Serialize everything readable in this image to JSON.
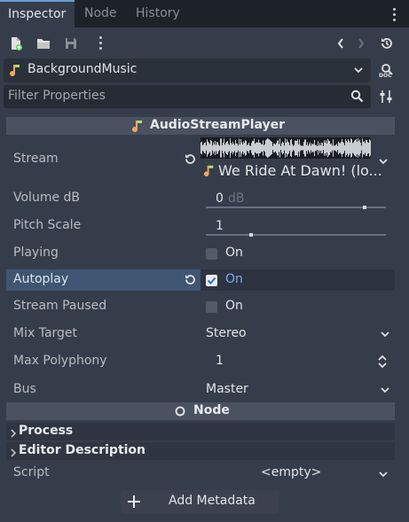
{
  "tabs": [
    {
      "label": "Inspector",
      "active": true
    },
    {
      "label": "Node",
      "active": false
    },
    {
      "label": "History",
      "active": false
    }
  ],
  "object": {
    "name": "BackgroundMusic",
    "icon": "audio-stream-icon"
  },
  "filter": {
    "placeholder": "Filter Properties"
  },
  "section": {
    "title": "AudioStreamPlayer",
    "icon": "audio-stream-icon"
  },
  "props": {
    "stream": {
      "label": "Stream",
      "value": "We Ride At Dawn! (lo..."
    },
    "volume": {
      "label": "Volume dB",
      "value": "0",
      "unit": "dB",
      "level": 0.88
    },
    "pitch": {
      "label": "Pitch Scale",
      "value": "1",
      "level": 0.25
    },
    "playing": {
      "label": "Playing",
      "value": "On",
      "checked": false
    },
    "autoplay": {
      "label": "Autoplay",
      "value": "On",
      "checked": true
    },
    "paused": {
      "label": "Stream Paused",
      "value": "On",
      "checked": false
    },
    "mix": {
      "label": "Mix Target",
      "value": "Stereo"
    },
    "poly": {
      "label": "Max Polyphony",
      "value": "1"
    },
    "bus": {
      "label": "Bus",
      "value": "Master"
    }
  },
  "node_section": {
    "title": "Node"
  },
  "groups": {
    "process": "Process",
    "editor": "Editor Description"
  },
  "script": {
    "label": "Script",
    "value": "<empty>"
  },
  "add_metadata": "Add Metadata",
  "colors": {
    "accent": "#6a9fd8",
    "selected_row": "#3f5572",
    "background": "#363d4a"
  }
}
